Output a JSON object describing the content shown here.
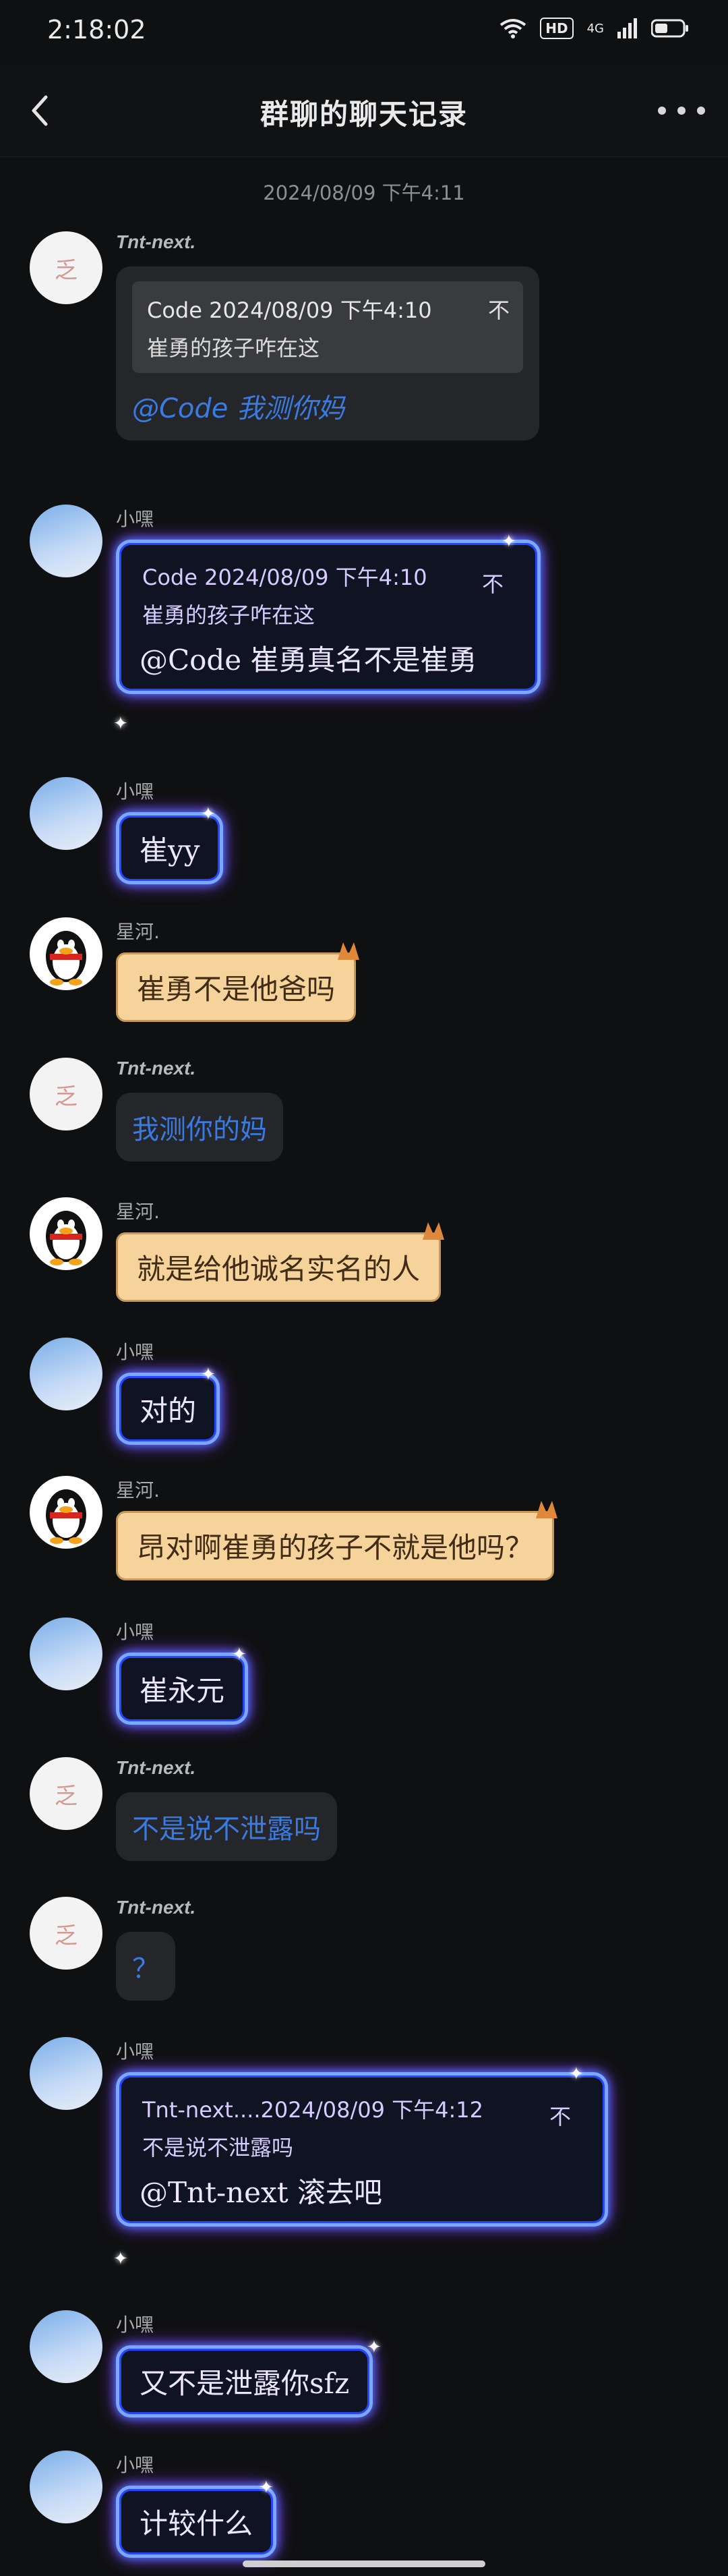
{
  "status": {
    "time": "2:18:02",
    "hd": "HD",
    "net": "4G"
  },
  "header": {
    "title": "群聊的聊天记录"
  },
  "timestamp": "2024/08/09 下午4:11",
  "colors": {
    "background": "#0f1012",
    "link": "#3a7be3",
    "neon": "#7ca6ff",
    "scroll": "#f5d39a"
  },
  "messages": [
    {
      "sender": "Tnt-next.",
      "avatar": "tnt-avatar",
      "style": "plain",
      "quote": {
        "header": "Code 2024/08/09 下午4:10",
        "pin": "不",
        "body": "崔勇的孩子咋在这"
      },
      "text": "@Code 我测你妈"
    },
    {
      "sender": "小嘿",
      "avatar": "cloud-avatar",
      "style": "neon",
      "quote": {
        "header": "Code 2024/08/09 下午4:10",
        "pin": "不",
        "body": "崔勇的孩子咋在这"
      },
      "text": "@Code 崔勇真名不是崔勇"
    },
    {
      "sender": "小嘿",
      "avatar": "cloud-avatar",
      "style": "neon",
      "text": "崔yy"
    },
    {
      "sender": "星河.",
      "avatar": "penguin-avatar",
      "style": "scroll",
      "text": "崔勇不是他爸吗"
    },
    {
      "sender": "Tnt-next.",
      "avatar": "tnt-avatar",
      "style": "plain",
      "text": "我测你的妈"
    },
    {
      "sender": "星河.",
      "avatar": "penguin-avatar",
      "style": "scroll",
      "text": "就是给他诚名实名的人"
    },
    {
      "sender": "小嘿",
      "avatar": "cloud-avatar",
      "style": "neon",
      "text": "对的"
    },
    {
      "sender": "星河.",
      "avatar": "penguin-avatar",
      "style": "scroll",
      "text": "昂对啊崔勇的孩子不就是他吗？"
    },
    {
      "sender": "小嘿",
      "avatar": "cloud-avatar",
      "style": "neon",
      "text": "崔永元"
    },
    {
      "sender": "Tnt-next.",
      "avatar": "tnt-avatar",
      "style": "plain",
      "text": "不是说不泄露吗"
    },
    {
      "sender": "Tnt-next.",
      "avatar": "tnt-avatar",
      "style": "plain",
      "text": "？"
    },
    {
      "sender": "小嘿",
      "avatar": "cloud-avatar",
      "style": "neon",
      "quote": {
        "header": "Tnt-next....2024/08/09 下午4:12",
        "pin": "不",
        "body": "不是说不泄露吗"
      },
      "text": "@Tnt-next 滚去吧"
    },
    {
      "sender": "小嘿",
      "avatar": "cloud-avatar",
      "style": "neon",
      "text": "又不是泄露你sfz"
    },
    {
      "sender": "小嘿",
      "avatar": "cloud-avatar",
      "style": "neon",
      "text": "计较什么"
    }
  ]
}
